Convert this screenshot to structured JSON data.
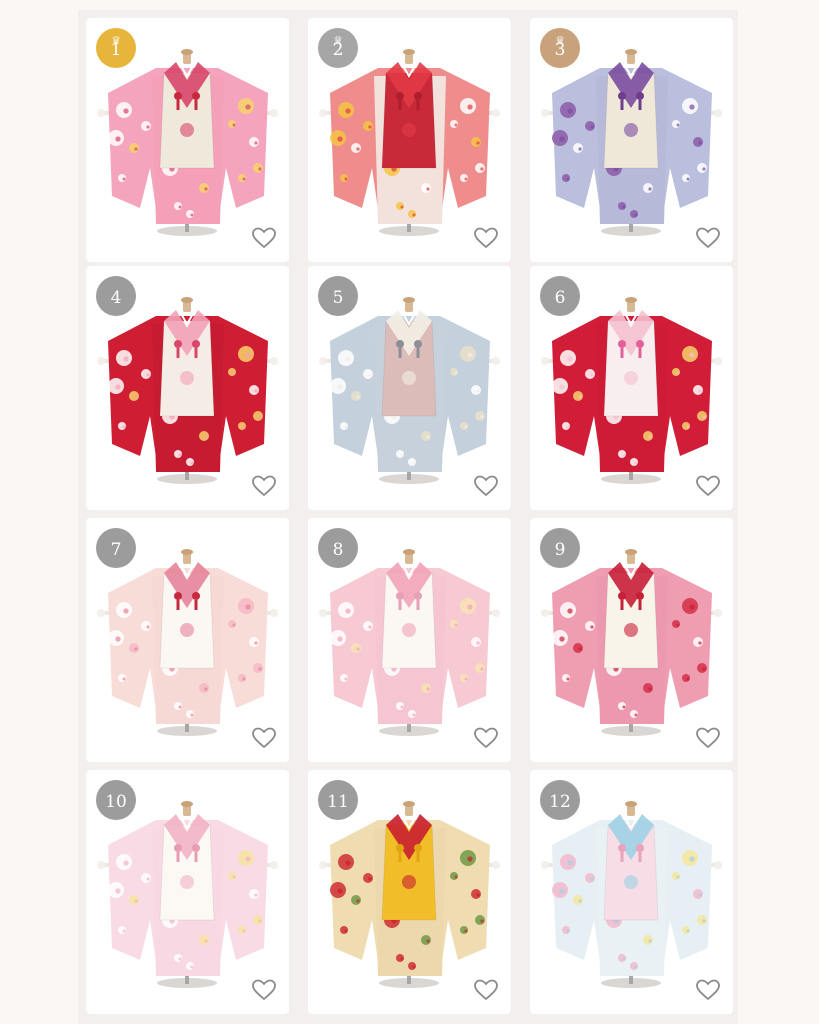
{
  "items": [
    {
      "rank": "1",
      "badge_color": "#e7b53b",
      "crown": true,
      "crown_icon": "crown-icon",
      "colors": {
        "sleeve": "#f4a4bc",
        "vest": "#efe9dc",
        "body": "#f3a0b8",
        "accent": "#d8466a",
        "dot1": "#ffffff",
        "dot2": "#f6d36a",
        "cord": "#c8293e"
      }
    },
    {
      "rank": "2",
      "badge_color": "#a6a6a6",
      "crown": true,
      "crown_icon": "crown-icon",
      "colors": {
        "sleeve": "#ef8d8d",
        "vest": "#c92a3a",
        "body": "#f3e1dc",
        "accent": "#e23a45",
        "dot1": "#f5c444",
        "dot2": "#ffffff",
        "cord": "#b01e2e"
      }
    },
    {
      "rank": "3",
      "badge_color": "#c7a27c",
      "crown": true,
      "crown_icon": "crown-icon",
      "colors": {
        "sleeve": "#b9bfdc",
        "vest": "#efe8d9",
        "body": "#b6b9d8",
        "accent": "#7b4da0",
        "dot1": "#8c5aa8",
        "dot2": "#ffffff",
        "cord": "#6e3d8e"
      }
    },
    {
      "rank": "4",
      "badge_color": "#9c9c9c",
      "crown": false,
      "colors": {
        "sleeve": "#cf1e33",
        "vest": "#f5ece5",
        "body": "#c61b30",
        "accent": "#f2a2b6",
        "dot1": "#ffffff",
        "dot2": "#f6d36a",
        "cord": "#d8466a"
      }
    },
    {
      "rank": "5",
      "badge_color": "#9c9c9c",
      "crown": false,
      "colors": {
        "sleeve": "#c4d0dc",
        "vest": "#dcbcb8",
        "body": "#c7d1dc",
        "accent": "#f3eee6",
        "dot1": "#ffffff",
        "dot2": "#e9dfc9",
        "cord": "#8d8e95"
      }
    },
    {
      "rank": "6",
      "badge_color": "#9c9c9c",
      "crown": false,
      "colors": {
        "sleeve": "#d11d37",
        "vest": "#f8eef0",
        "body": "#cf1c36",
        "accent": "#f4c0cf",
        "dot1": "#ffffff",
        "dot2": "#f6d36a",
        "cord": "#e3609a"
      }
    },
    {
      "rank": "7",
      "badge_color": "#9c9c9c",
      "crown": false,
      "colors": {
        "sleeve": "#f8dcd8",
        "vest": "#fbf7f2",
        "body": "#f6d8d5",
        "accent": "#e5839a",
        "dot1": "#ffffff",
        "dot2": "#f4b8c6",
        "cord": "#c8293e"
      }
    },
    {
      "rank": "8",
      "badge_color": "#9c9c9c",
      "crown": false,
      "colors": {
        "sleeve": "#f6c9d3",
        "vest": "#fbf8f3",
        "body": "#f5c6d2",
        "accent": "#f2a3b8",
        "dot1": "#ffffff",
        "dot2": "#f8e3b4",
        "cord": "#e6a1b4"
      }
    },
    {
      "rank": "9",
      "badge_color": "#9c9c9c",
      "crown": false,
      "colors": {
        "sleeve": "#ef9db1",
        "vest": "#f8f4ea",
        "body": "#ec98ae",
        "accent": "#c81f38",
        "dot1": "#ffffff",
        "dot2": "#d33049",
        "cord": "#c81f38"
      }
    },
    {
      "rank": "10",
      "badge_color": "#9c9c9c",
      "crown": false,
      "colors": {
        "sleeve": "#f9dbe5",
        "vest": "#fcf8f3",
        "body": "#f8d8e3",
        "accent": "#f2b2c6",
        "dot1": "#ffffff",
        "dot2": "#f6e4a0",
        "cord": "#e89db2"
      }
    },
    {
      "rank": "11",
      "badge_color": "#9c9c9c",
      "crown": false,
      "colors": {
        "sleeve": "#efdcb0",
        "vest": "#f1bd28",
        "body": "#ecd8ac",
        "accent": "#c81f2e",
        "dot1": "#d02e36",
        "dot2": "#6e9a48",
        "cord": "#e2a312"
      }
    },
    {
      "rank": "12",
      "badge_color": "#9c9c9c",
      "crown": false,
      "colors": {
        "sleeve": "#e6eff4",
        "vest": "#f7dde6",
        "body": "#eaf1f4",
        "accent": "#9fd0e4",
        "dot1": "#f2b8cc",
        "dot2": "#f6e69a",
        "cord": "#e8a4bc"
      }
    }
  ],
  "icons": {
    "favorite": "heart-outline-icon"
  }
}
